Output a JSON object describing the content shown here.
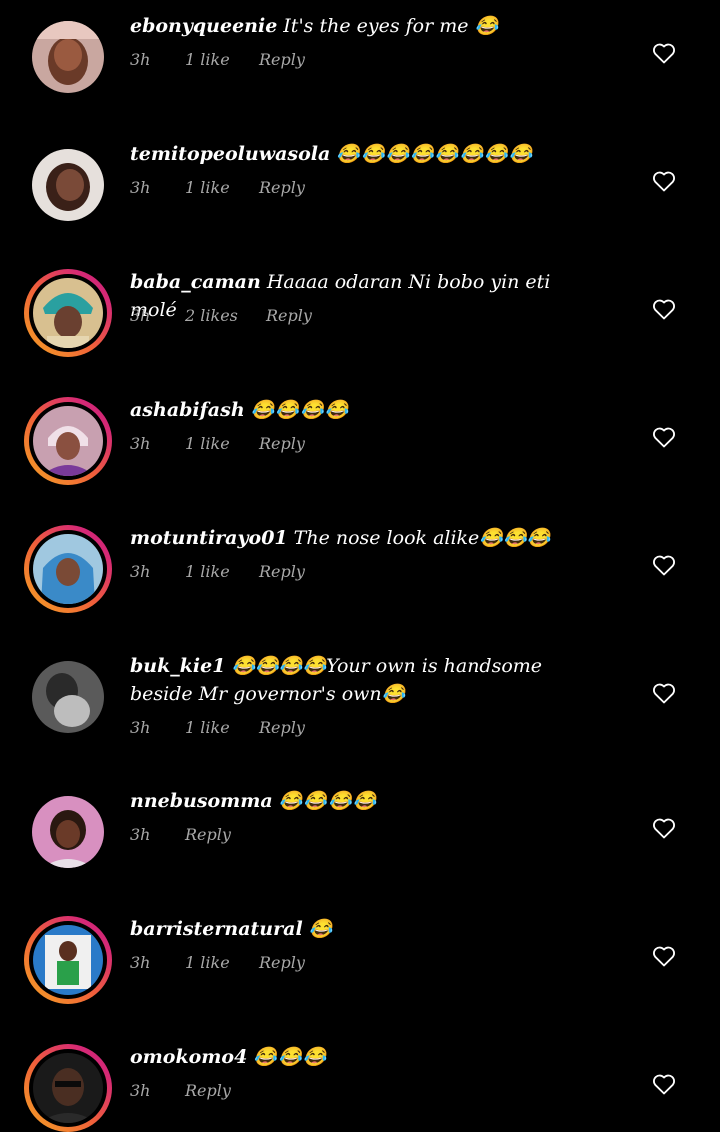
{
  "comments": [
    {
      "username": "ebonyqueenie",
      "text": "It's the eyes for me 😂",
      "time": "3h",
      "likes": "1 like",
      "reply": "Reply",
      "ring": false,
      "avatar_color": "#b5705a"
    },
    {
      "username": "temitopeoluwasola",
      "text": "😂😂😂😂😂😂😂😂",
      "time": "3h",
      "likes": "1 like",
      "reply": "Reply",
      "ring": false,
      "avatar_color": "#8a5a4a"
    },
    {
      "username": "baba_caman",
      "text": "Haaaa odaran Ni bobo yin eti molé",
      "time": "3h",
      "likes": "2 likes",
      "reply": "Reply",
      "ring": true,
      "avatar_color": "#c9a060"
    },
    {
      "username": "ashabifash",
      "text": "😂😂😂😂",
      "time": "3h",
      "likes": "1 like",
      "reply": "Reply",
      "ring": true,
      "avatar_color": "#d8b8c8"
    },
    {
      "username": "motuntirayo01",
      "text": "The nose look alike😂😂😂",
      "time": "3h",
      "likes": "1 like",
      "reply": "Reply",
      "ring": true,
      "avatar_color": "#4a90c0"
    },
    {
      "username": "buk_kie1",
      "text": "😂😂😂😂Your own is handsome beside Mr governor's own😂",
      "time": "3h",
      "likes": "1 like",
      "reply": "Reply",
      "ring": false,
      "avatar_color": "#9a9a9a"
    },
    {
      "username": "nnebusomma",
      "text": "😂😂😂😂",
      "time": "3h",
      "likes": "",
      "reply": "Reply",
      "ring": false,
      "avatar_color": "#6a3a2a"
    },
    {
      "username": "barristernatural",
      "text": "😂",
      "time": "3h",
      "likes": "1 like",
      "reply": "Reply",
      "ring": true,
      "avatar_color": "#3aa0d8"
    },
    {
      "username": "omokomo4",
      "text": "😂😂😂",
      "time": "3h",
      "likes": "",
      "reply": "Reply",
      "ring": true,
      "avatar_color": "#3a2a22"
    }
  ],
  "colors": {
    "background": "#000000",
    "meta_text": "#a8a8a8",
    "story_ring_start": "#f5a623",
    "story_ring_end": "#c21f72"
  },
  "icons": {
    "like": "heart-outline-icon"
  }
}
